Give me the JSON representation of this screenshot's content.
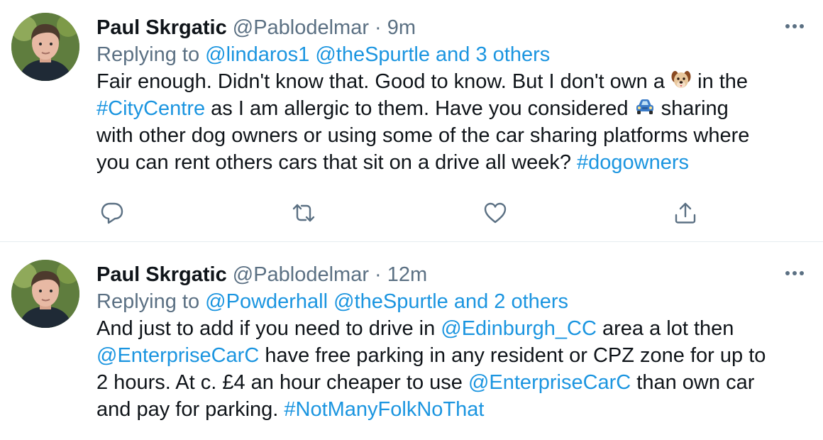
{
  "tweets": [
    {
      "author_name": "Paul Skrgatic",
      "author_handle": "@Pablodelmar",
      "separator": "·",
      "time": "9m",
      "replying_prefix": "Replying to",
      "replying_users": "@lindaros1 @theSpurtle and 3 others",
      "body": {
        "l1_a": "Fair enough. Didn't know that. Good to know. But I don't own a ",
        "l1_emoji": "dog-face-emoji",
        "l1_b": " in the",
        "l2_hashtag": "#CityCentre",
        "l2_a": " as I am allergic to them. Have you considered ",
        "l2_emoji": "car-emoji",
        "l2_b": " sharing",
        "l3": "with other dog owners or using some of the car sharing platforms where",
        "l4_a": "you can rent others cars that sit on a drive all week? ",
        "l4_hashtag": "#dogowners"
      },
      "more_icon": "more-icon",
      "actions": [
        "reply-icon",
        "retweet-icon",
        "like-icon",
        "share-icon"
      ]
    },
    {
      "author_name": "Paul Skrgatic",
      "author_handle": "@Pablodelmar",
      "separator": "·",
      "time": "12m",
      "replying_prefix": "Replying to",
      "replying_users": "@Powderhall @theSpurtle and 2 others",
      "body": {
        "l1_a": "And just to add if you need to drive in ",
        "l1_mention": "@Edinburgh_CC",
        "l1_b": " area a lot then",
        "l2_mention": "@EnterpriseCarC",
        "l2_a": " have free parking in any resident or CPZ zone for up to",
        "l3_a": "2 hours. At c. £4 an hour cheaper to use ",
        "l3_mention": "@EnterpriseCarC",
        "l3_b": " than own car",
        "l4_a": "and pay for parking. ",
        "l4_hashtag": "#NotManyFolkNoThat"
      },
      "more_icon": "more-icon"
    }
  ],
  "colors": {
    "link": "#1b95e0",
    "secondary_text": "#5b7083",
    "primary_text": "#0f1419",
    "divider": "#e6ecf0"
  }
}
